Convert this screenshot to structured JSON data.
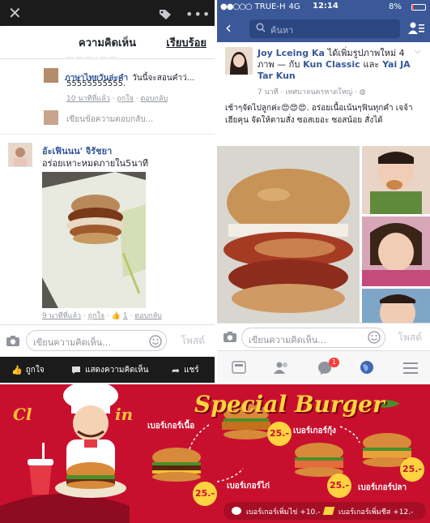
{
  "left_panel": {
    "sheet_title": "ความคิดเห็น",
    "done_label": "เรียบร้อย",
    "reply": {
      "name": "ภาษาไทยวันล่ะคำ",
      "text_line1": "วันนี้จะสอนคำว่...",
      "text_line2": "55555555555.",
      "time": "10 นาทีที่แล้ว",
      "like": "ถูกใจ",
      "reply": "ตอบกลับ"
    },
    "reply_input_placeholder": "เขียนข้อความตอบกลับ...",
    "comment": {
      "name": "อัะเฟินนน' จิรัชยา",
      "text": "อร่อยเหาะหมดภายใน5นาที",
      "time": "9 นาทีที่แล้ว",
      "like": "ถูกใจ",
      "like_count": "1",
      "reply": "ตอบกลับ"
    },
    "composer_placeholder": "เขียนความคิดเห็น...",
    "post_label": "โพสต์",
    "bottom_actions": {
      "like": "ถูกใจ",
      "comment": "แสดงความคิดเห็น",
      "share": "แชร์"
    }
  },
  "right_panel": {
    "status": {
      "carrier": "TRUE-H",
      "network": "4G",
      "time": "12:14",
      "battery": "8%"
    },
    "search_placeholder": "ค้นหา",
    "post": {
      "author": "Joy Lceing Ka",
      "action": "ได้เพิ่มรูปภาพใหม่ 4 ภาพ — กับ",
      "tag1": "Kun Classic",
      "and": "และ",
      "tag2": "Yai JA Tar Kun",
      "time": "7 นาที",
      "location": "เทศบาลนครหาดใหญ่",
      "text": "เช้าๆจัดไปลูกค่ะ😍😍😍. อร่อยเนื้อเน้นๆฟินทุกคำ เจจ้า เฮียคุน จัดให้ตามสั่ง ซอสเยอะ ซอสน้อย สั่งได้"
    },
    "composer_placeholder": "เขียนความคิดเห็น...",
    "post_label": "โพสต์",
    "messenger_badge": "1"
  },
  "banner": {
    "title": "Special Burger",
    "items": [
      {
        "label": "เบอร์เกอร์เนื้อ",
        "price": "25.-"
      },
      {
        "label": "เบอร์เกอร์กุ้ง",
        "price": "25.-"
      },
      {
        "label": "เบอร์เกอร์ไก่",
        "price": "25.-"
      },
      {
        "label": "เบอร์เกอร์ปลา",
        "price": "25.-"
      }
    ],
    "addon1": "เบอร์เกอร์เพิ่มไข่ +10.-",
    "addon2": "เบอร์เกอร์เพิ่มชีส +12.-"
  },
  "colors": {
    "facebook_blue": "#3b5998",
    "link_blue": "#365899",
    "banner_red": "#c8102e",
    "banner_yellow": "#ffd23f"
  }
}
